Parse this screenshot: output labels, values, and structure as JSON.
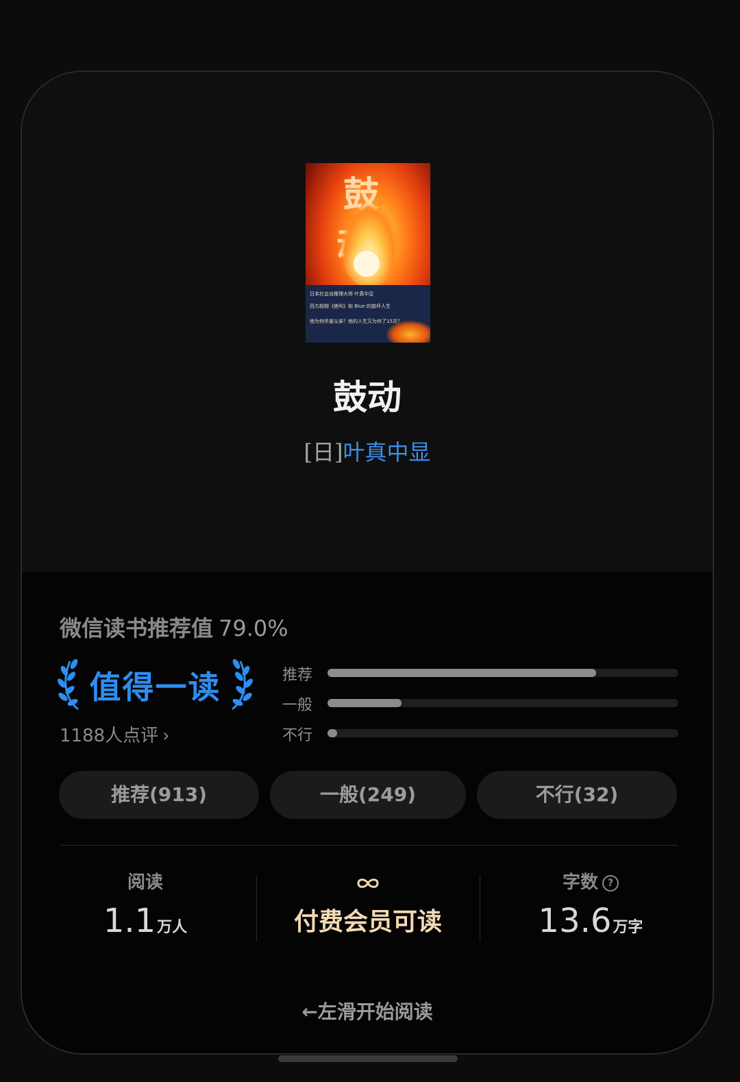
{
  "book": {
    "cover": {
      "title_text": "鼓 动",
      "band_lines": [
        "日本社会派推理大师 叶真中显",
        "西方超越《绝叫》和 Blue 的崩坏人生",
        "他为何杀害父亲？他的人生又为何了15次？"
      ]
    },
    "title": "鼓动",
    "author_prefix": "[日]",
    "author_name": "叶真中显"
  },
  "rating": {
    "label": "微信读书推荐值",
    "value": "79.0%",
    "badge": "值得一读",
    "review_count": "1188人点评",
    "bars": [
      {
        "label": "推荐",
        "fraction": 0.766
      },
      {
        "label": "一般",
        "fraction": 0.21
      },
      {
        "label": "不行",
        "fraction": 0.027
      }
    ]
  },
  "votes": {
    "recommend": "推荐(913)",
    "average": "一般(249)",
    "bad": "不行(32)"
  },
  "stats": {
    "reading_label": "阅读",
    "reading_value": "1.1",
    "reading_unit": "万人",
    "membership_icon": "infinity-icon",
    "membership_value": "付费会员可读",
    "words_label": "字数",
    "words_value": "13.6",
    "words_unit": "万字"
  },
  "swipe_hint": "←左滑开始阅读",
  "colors": {
    "accent_blue": "#2d8ef0",
    "author_blue": "#3d8ee8",
    "member_gold": "#f4d9b3"
  }
}
